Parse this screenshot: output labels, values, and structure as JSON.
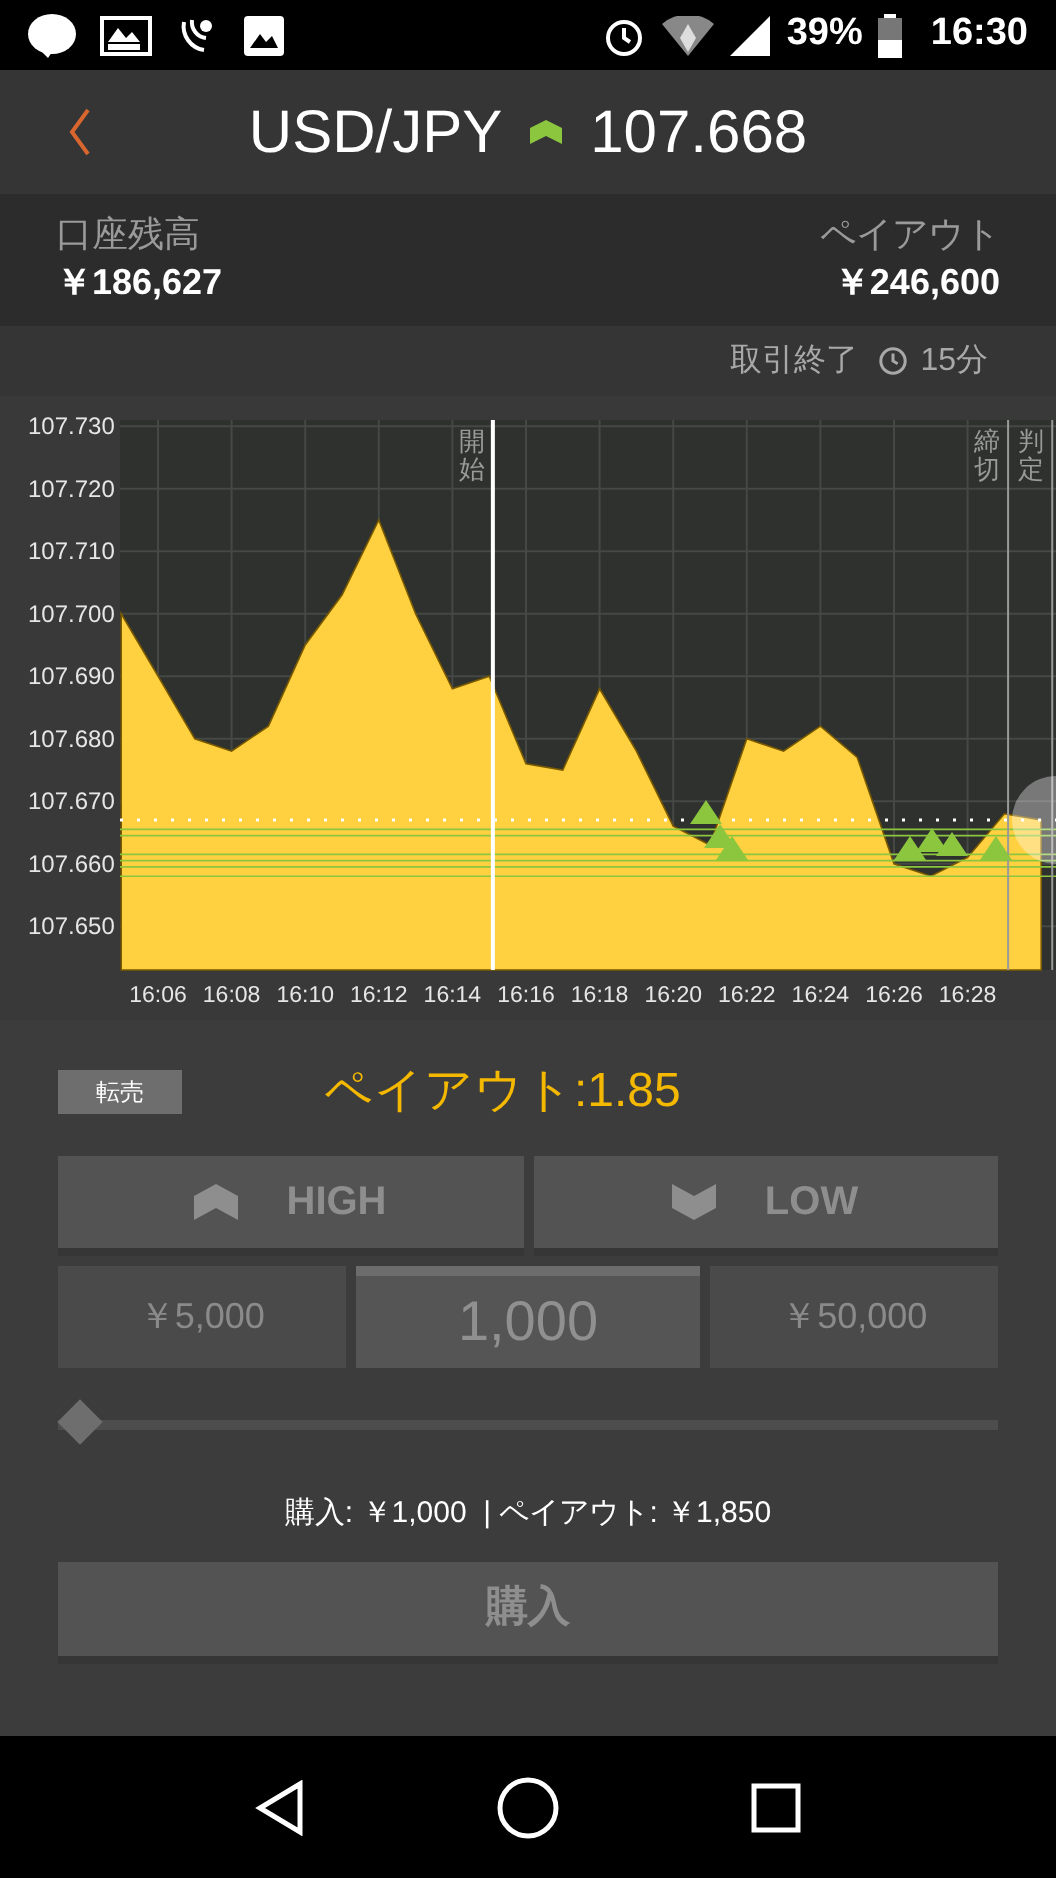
{
  "status_bar": {
    "battery": "39%",
    "time": "16:30"
  },
  "header": {
    "pair": "USD/JPY",
    "rising": true,
    "rate": "107.668"
  },
  "account": {
    "balance_label": "口座残高",
    "balance": "￥186,627",
    "payout_label": "ペイアウト",
    "payout": "￥246,600"
  },
  "trade_end": {
    "label": "取引終了",
    "remaining": "15分"
  },
  "chart": {
    "chart_data": {
      "type": "area",
      "categories": [
        null,
        "16:06",
        null,
        "16:08",
        null,
        "16:10",
        null,
        "16:12",
        null,
        "16:14",
        null,
        "16:16",
        null,
        "16:18",
        null,
        "16:20",
        null,
        "16:22",
        null,
        "16:24",
        null,
        "16:26",
        null,
        "16:28",
        null,
        null
      ],
      "series": [
        {
          "color": "#ffd040",
          "values": [
            107.7,
            107.69,
            107.68,
            107.678,
            107.682,
            107.695,
            107.703,
            107.715,
            107.7,
            107.688,
            107.69,
            107.676,
            107.675,
            107.688,
            107.678,
            107.666,
            107.663,
            107.68,
            107.678,
            107.682,
            107.677,
            107.66,
            107.658,
            107.661,
            107.668,
            107.667
          ]
        }
      ],
      "ylim": [
        107.643,
        107.731
      ],
      "grid": true,
      "yticks": [
        {
          "value": 107.65,
          "label": "107.650"
        },
        {
          "value": 107.66,
          "label": "107.660"
        },
        {
          "value": 107.67,
          "label": "107.670"
        },
        {
          "value": 107.68,
          "label": "107.680"
        },
        {
          "value": 107.69,
          "label": "107.690"
        },
        {
          "value": 107.7,
          "label": "107.700"
        },
        {
          "value": 107.71,
          "label": "107.710"
        },
        {
          "value": 107.72,
          "label": "107.720"
        },
        {
          "value": 107.73,
          "label": "107.730"
        }
      ],
      "ref_lines": [
        {
          "axis": "y",
          "value": 107.667,
          "color": "#ffffff"
        },
        {
          "axis": "y",
          "value": 107.6655,
          "color": "#8cc63f"
        },
        {
          "axis": "y",
          "value": 107.6645,
          "color": "#8cc63f"
        },
        {
          "axis": "y",
          "value": 107.6615,
          "color": "#8cc63f"
        },
        {
          "axis": "y",
          "value": 107.6605,
          "color": "#8cc63f"
        },
        {
          "axis": "y",
          "value": 107.6595,
          "color": "#8cc63f"
        },
        {
          "axis": "y",
          "value": 107.658,
          "color": "#8cc63f"
        }
      ]
    },
    "time_markers": [
      {
        "label": "開始"
      },
      {
        "label": "締切"
      },
      {
        "label": "判定"
      }
    ]
  },
  "order": {
    "resell_button": "転売",
    "payout_rate": "ペイアウト:1.85",
    "directions": [
      {
        "kind": "high",
        "label": "HIGH",
        "disabled": true
      },
      {
        "kind": "low",
        "label": "LOW",
        "disabled": true
      }
    ],
    "amounts": [
      {
        "label": "￥5,000",
        "selected": false
      },
      {
        "label": "1,000",
        "selected": true
      },
      {
        "label": "￥50,000",
        "selected": false
      }
    ],
    "slider": {
      "level": 0
    },
    "summary": "購入: ￥1,000  | ペイアウト: ￥1,850",
    "buy_button": {
      "label": "購入",
      "disabled": true
    }
  }
}
